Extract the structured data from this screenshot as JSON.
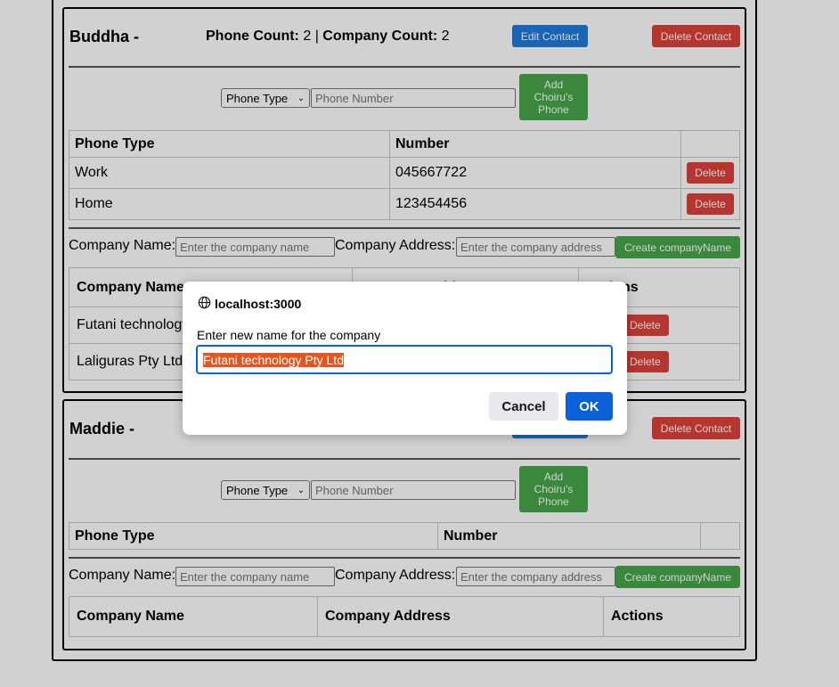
{
  "contacts": [
    {
      "name": "Buddha -",
      "phone_count_label": "Phone Count:",
      "phone_count": "2",
      "separator": "|",
      "company_count_label": "Company Count:",
      "company_count": "2",
      "edit_label": "Edit Contact",
      "delete_label": "Delete Contact",
      "phone_type_select": "Phone Type",
      "phone_number_placeholder": "Phone Number",
      "add_phone_label": "Add Choiru's Phone",
      "phone_headers": [
        "Phone Type",
        "Number",
        ""
      ],
      "phones": [
        {
          "type": "Work",
          "number": "045667722",
          "action": "Delete"
        },
        {
          "type": "Home",
          "number": "123454456",
          "action": "Delete"
        }
      ],
      "company_name_label": "Company Name:",
      "company_name_placeholder": "Enter the company name",
      "company_address_label": "Company Address:",
      "company_address_placeholder": "Enter the company address",
      "create_company_label": "Create companyName",
      "company_headers": [
        "Company Name",
        "Company Address",
        "Actions"
      ],
      "companies": [
        {
          "name": "Futani technology Pty Ltd",
          "address": "",
          "action": "Delete"
        },
        {
          "name": "Laliguras Pty Ltd",
          "address": "",
          "action": "Delete"
        }
      ]
    },
    {
      "name": "Maddie -",
      "delete_label": "Delete Contact",
      "phone_type_select": "Phone Type",
      "phone_number_placeholder": "Phone Number",
      "add_phone_label": "Add Choiru's Phone",
      "phone_headers": [
        "Phone Type",
        "Number",
        ""
      ],
      "company_name_label": "Company Name:",
      "company_name_placeholder": "Enter the company name",
      "company_address_label": "Company Address:",
      "company_address_placeholder": "Enter the company address",
      "create_company_label": "Create companyName",
      "company_headers": [
        "Company Name",
        "Company Address",
        "Actions"
      ]
    }
  ],
  "dialog": {
    "origin": "localhost:3000",
    "origin_icon": "globe-icon",
    "message": "Enter new name for the company",
    "value": "Futani technology Pty Ltd",
    "cancel_label": "Cancel",
    "ok_label": "OK"
  }
}
